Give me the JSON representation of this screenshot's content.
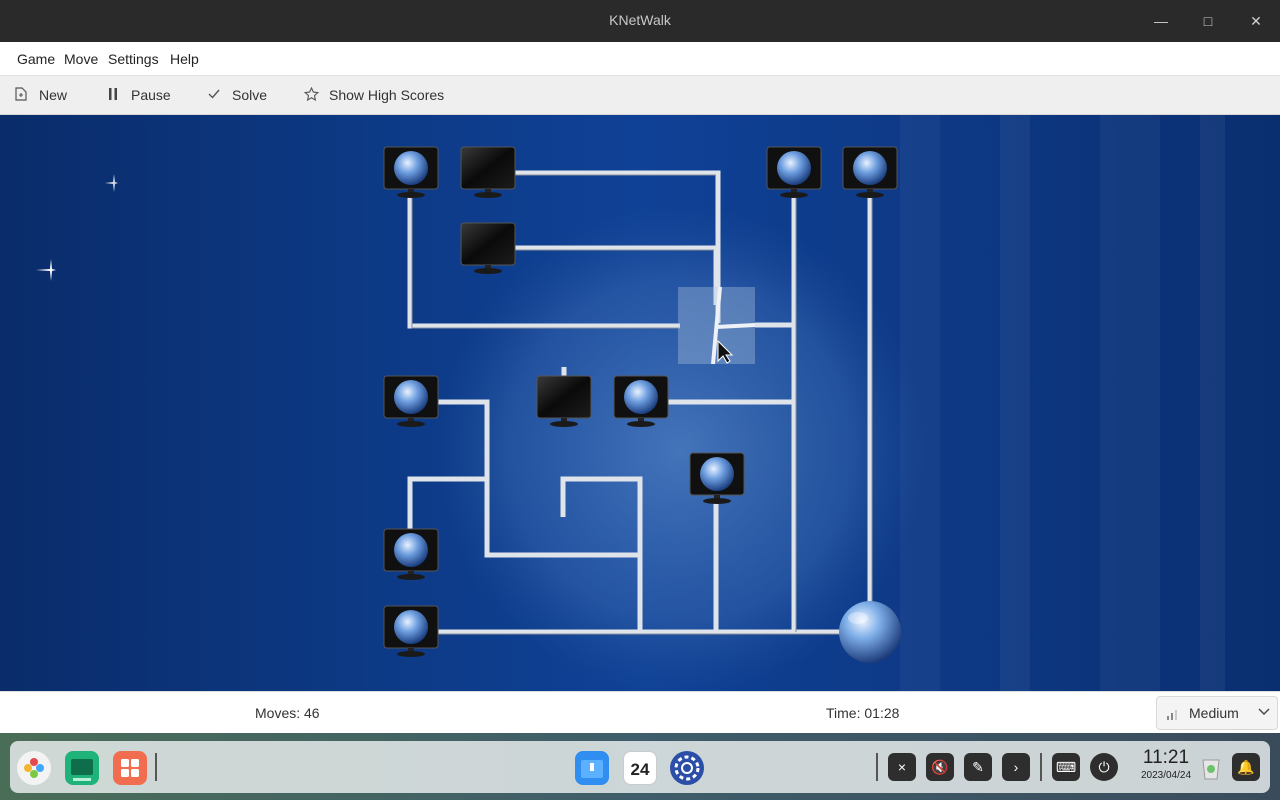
{
  "window": {
    "title": "KNetWalk",
    "minimize_icon": "minimize-icon",
    "maximize_icon": "maximize-icon",
    "close_icon": "close-icon"
  },
  "menubar": {
    "items": [
      "Game",
      "Move",
      "Settings",
      "Help"
    ]
  },
  "toolbar": {
    "new_label": "New",
    "new_icon": "new-document-icon",
    "pause_label": "Pause",
    "pause_icon": "pause-icon",
    "solve_label": "Solve",
    "solve_icon": "checkmark-icon",
    "highscores_label": "Show High Scores",
    "highscores_icon": "star-icon"
  },
  "status": {
    "moves": "Moves: 46",
    "time": "Time: 01:28",
    "difficulty": "Medium"
  },
  "taskbar": {
    "launcher_icon": "launcher-icon",
    "terminal_icon": "terminal-icon",
    "apps_icon": "app-store-icon",
    "files_icon": "file-manager-icon",
    "calendar_day": "24",
    "settings_icon": "settings-icon",
    "tray_icons": [
      "notification-blocked-icon",
      "mute-icon",
      "pen-off-icon",
      "chevron-right-icon",
      "keyboard-icon",
      "power-icon"
    ],
    "clock_time": "11:21",
    "clock_date": "2023/04/24",
    "trash_icon": "trash-icon",
    "notifications_icon": "bell-icon"
  }
}
